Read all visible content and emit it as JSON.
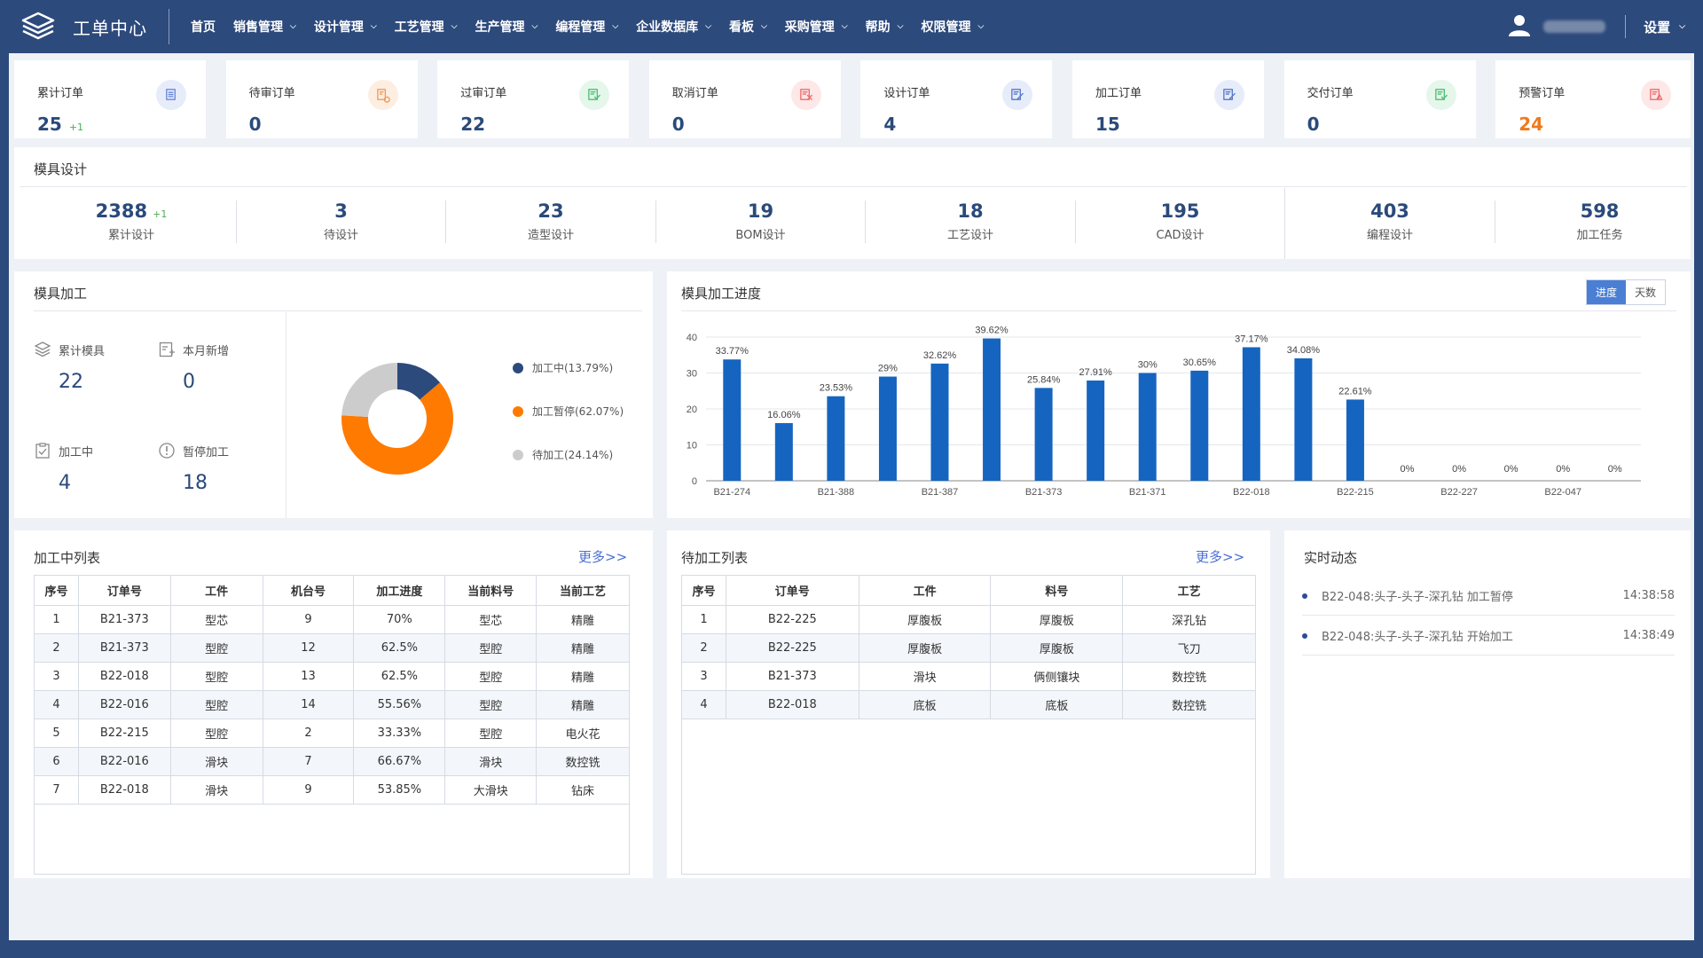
{
  "app": {
    "title": "工单中心"
  },
  "nav": {
    "items": [
      {
        "label": "首页",
        "dropdown": false
      },
      {
        "label": "销售管理",
        "dropdown": true
      },
      {
        "label": "设计管理",
        "dropdown": true
      },
      {
        "label": "工艺管理",
        "dropdown": true
      },
      {
        "label": "生产管理",
        "dropdown": true
      },
      {
        "label": "编程管理",
        "dropdown": true
      },
      {
        "label": "企业数据库",
        "dropdown": true
      },
      {
        "label": "看板",
        "dropdown": true
      },
      {
        "label": "采购管理",
        "dropdown": true
      },
      {
        "label": "帮助",
        "dropdown": true
      },
      {
        "label": "权限管理",
        "dropdown": true
      }
    ],
    "settings_label": "设置",
    "user_icon": "user-icon"
  },
  "colors": {
    "nav_bg": "#2d4a7c",
    "accent": "#1565c0",
    "warn": "#f07a1a",
    "processing": "#2d4a7c",
    "paused": "#ff7a00",
    "waiting": "#cccccc"
  },
  "stats": [
    {
      "label": "累计订单",
      "value": "25",
      "delta": "+1",
      "icon": "list-icon",
      "icon_bg": "#e6ecfa",
      "icon_color": "#6a86d8"
    },
    {
      "label": "待审订单",
      "value": "0",
      "delta": "",
      "icon": "pending-icon",
      "icon_bg": "#fdeee2",
      "icon_color": "#f29a5a"
    },
    {
      "label": "过审订单",
      "value": "22",
      "delta": "",
      "icon": "approved-icon",
      "icon_bg": "#e5f6ea",
      "icon_color": "#4cbf74"
    },
    {
      "label": "取消订单",
      "value": "0",
      "delta": "",
      "icon": "cancel-icon",
      "icon_bg": "#fde7e7",
      "icon_color": "#ef6b6b"
    },
    {
      "label": "设计订单",
      "value": "4",
      "delta": "",
      "icon": "design-icon",
      "icon_bg": "#e6ecfa",
      "icon_color": "#5878c8"
    },
    {
      "label": "加工订单",
      "value": "15",
      "delta": "",
      "icon": "process-icon",
      "icon_bg": "#e6ecfa",
      "icon_color": "#5878c8"
    },
    {
      "label": "交付订单",
      "value": "0",
      "delta": "",
      "icon": "delivered-icon",
      "icon_bg": "#e5f6ea",
      "icon_color": "#4cbf74"
    },
    {
      "label": "预警订单",
      "value": "24",
      "delta": "",
      "icon": "warning-icon",
      "icon_bg": "#fde7e7",
      "icon_color": "#ef6b6b",
      "warn": true
    }
  ],
  "design": {
    "title": "模具设计",
    "items": [
      {
        "value": "2388",
        "delta": "+1",
        "label": "累计设计"
      },
      {
        "value": "3",
        "delta": "",
        "label": "待设计"
      },
      {
        "value": "23",
        "delta": "",
        "label": "造型设计"
      },
      {
        "value": "19",
        "delta": "",
        "label": "BOM设计"
      },
      {
        "value": "18",
        "delta": "",
        "label": "工艺设计"
      },
      {
        "value": "195",
        "delta": "",
        "label": "CAD设计"
      },
      {
        "value": "403",
        "delta": "",
        "label": "编程设计"
      },
      {
        "value": "598",
        "delta": "",
        "label": "加工任务"
      }
    ]
  },
  "machining": {
    "title": "模具加工",
    "stats": [
      {
        "label": "累计模具",
        "value": "22",
        "icon": "layers-icon"
      },
      {
        "label": "本月新增",
        "value": "0",
        "icon": "add-doc-icon"
      },
      {
        "label": "加工中",
        "value": "4",
        "icon": "checklist-icon"
      },
      {
        "label": "暂停加工",
        "value": "18",
        "icon": "alert-icon"
      }
    ],
    "legend": [
      {
        "label": "加工中(13.79%)",
        "color": "#2d4a7c"
      },
      {
        "label": "加工暂停(62.07%)",
        "color": "#ff7a00"
      },
      {
        "label": "待加工(24.14%)",
        "color": "#cccccc"
      }
    ]
  },
  "progress": {
    "title": "模具加工进度",
    "toggle": {
      "active": "进度",
      "inactive": "天数"
    }
  },
  "chart_data": [
    {
      "type": "pie",
      "labels": [
        "加工中",
        "加工暂停",
        "待加工"
      ],
      "values": [
        13.79,
        62.07,
        24.14
      ],
      "colors": [
        "#2d4a7c",
        "#ff7a00",
        "#cccccc"
      ],
      "donut": true
    },
    {
      "type": "bar",
      "title": "",
      "categories": [
        "B21-274",
        "",
        "B21-388",
        "",
        "B21-387",
        "",
        "B21-373",
        "",
        "B21-371",
        "",
        "B22-018",
        "",
        "B22-215",
        "",
        "B22-227",
        "",
        "B22-047",
        ""
      ],
      "values": [
        33.77,
        16.06,
        23.53,
        29,
        32.62,
        39.62,
        25.84,
        27.91,
        30,
        30.65,
        37.17,
        34.08,
        22.61,
        0,
        0,
        0,
        0,
        0
      ],
      "data_labels": [
        "33.77%",
        "16.06%",
        "23.53%",
        "29%",
        "32.62%",
        "39.62%",
        "25.84%",
        "27.91%",
        "30%",
        "30.65%",
        "37.17%",
        "34.08%",
        "22.61%",
        "0%",
        "0%",
        "0%",
        "0%",
        "0%"
      ],
      "yticks": [
        "0",
        "10",
        "20",
        "30",
        "40"
      ],
      "ylim": [
        0,
        40
      ],
      "grid": true,
      "color": "#1565c0"
    }
  ],
  "processing_list": {
    "title": "加工中列表",
    "more": "更多>>",
    "columns": [
      "序号",
      "订单号",
      "工件",
      "机台号",
      "加工进度",
      "当前料号",
      "当前工艺"
    ],
    "rows": [
      [
        "1",
        "B21-373",
        "型芯",
        "9",
        "70%",
        "型芯",
        "精雕"
      ],
      [
        "2",
        "B21-373",
        "型腔",
        "12",
        "62.5%",
        "型腔",
        "精雕"
      ],
      [
        "3",
        "B22-018",
        "型腔",
        "13",
        "62.5%",
        "型腔",
        "精雕"
      ],
      [
        "4",
        "B22-016",
        "型腔",
        "14",
        "55.56%",
        "型腔",
        "精雕"
      ],
      [
        "5",
        "B22-215",
        "型腔",
        "2",
        "33.33%",
        "型腔",
        "电火花"
      ],
      [
        "6",
        "B22-016",
        "滑块",
        "7",
        "66.67%",
        "滑块",
        "数控铣"
      ],
      [
        "7",
        "B22-018",
        "滑块",
        "9",
        "53.85%",
        "大滑块",
        "钻床"
      ]
    ]
  },
  "pending_list": {
    "title": "待加工列表",
    "more": "更多>>",
    "columns": [
      "序号",
      "订单号",
      "工件",
      "料号",
      "工艺"
    ],
    "rows": [
      [
        "1",
        "B22-225",
        "厚腹板",
        "厚腹板",
        "深孔钻"
      ],
      [
        "2",
        "B22-225",
        "厚腹板",
        "厚腹板",
        "飞刀"
      ],
      [
        "3",
        "B21-373",
        "滑块",
        "俩侧镶块",
        "数控铣"
      ],
      [
        "4",
        "B22-018",
        "底板",
        "底板",
        "数控铣"
      ]
    ]
  },
  "feed": {
    "title": "实时动态",
    "items": [
      {
        "text": "B22-048:头子-头子-深孔钻 加工暂停",
        "time": "14:38:58"
      },
      {
        "text": "B22-048:头子-头子-深孔钻 开始加工",
        "time": "14:38:49"
      }
    ]
  }
}
